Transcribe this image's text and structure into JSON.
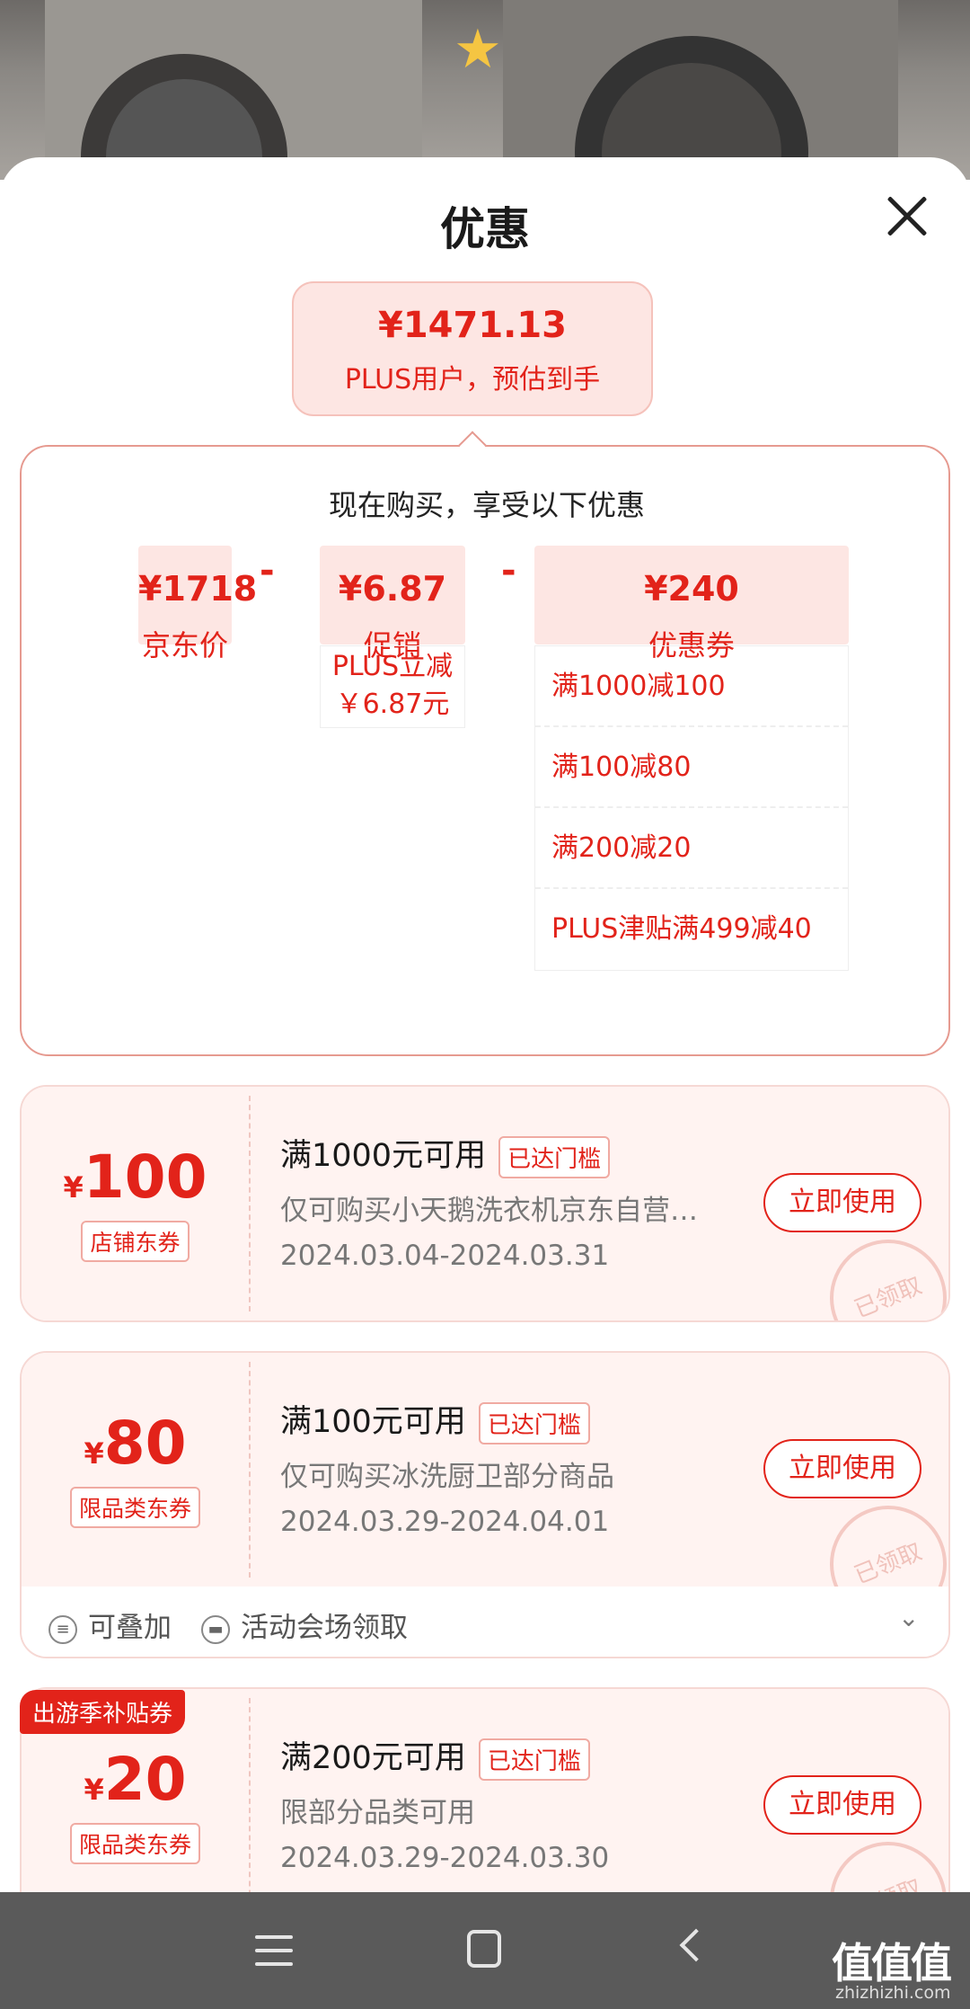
{
  "sheet": {
    "title": "优惠",
    "estimate": {
      "price": "¥1471.13",
      "label": "PLUS用户，预估到手"
    },
    "breakdown": {
      "title": "现在购买，享受以下优惠",
      "jd_price": {
        "value": "¥1718",
        "label": "京东价"
      },
      "minus": "-",
      "promo": {
        "value": "¥6.87",
        "label": "促销",
        "detail_line1": "PLUS立减",
        "detail_line2": "￥6.87元"
      },
      "coupon": {
        "value": "¥240",
        "label": "优惠券",
        "items": [
          "满1000减100",
          "满100减80",
          "满200减20",
          "PLUS津贴满499减40"
        ]
      }
    }
  },
  "coupons": [
    {
      "yen": "¥",
      "amount": "100",
      "type": "店铺东券",
      "title": "满1000元可用",
      "badge": "已达门槛",
      "scope": "仅可购买小天鹅洗衣机京东自营…",
      "date": "2024.03.04-2024.03.31",
      "button": "立即使用",
      "stamp": "已领取"
    },
    {
      "yen": "¥",
      "amount": "80",
      "type": "限品类东券",
      "title": "满100元可用",
      "badge": "已达门槛",
      "scope": "仅可购买冰洗厨卫部分商品",
      "date": "2024.03.29-2024.04.01",
      "button": "立即使用",
      "stamp": "已领取",
      "footer": {
        "stackable": "可叠加",
        "source": "活动会场领取"
      }
    },
    {
      "ribbon": "出游季补贴券",
      "yen": "¥",
      "amount": "20",
      "type": "限品类东券",
      "title": "满200元可用",
      "badge": "已达门槛",
      "scope": "限部分品类可用",
      "date": "2024.03.29-2024.03.30",
      "button": "立即使用",
      "stamp": "已领取"
    }
  ],
  "watermark": {
    "main": "值值值",
    "sub": "zhizhizhi.com"
  },
  "colors": {
    "accent": "#e2231a",
    "pink_bg": "#fde6e3"
  }
}
